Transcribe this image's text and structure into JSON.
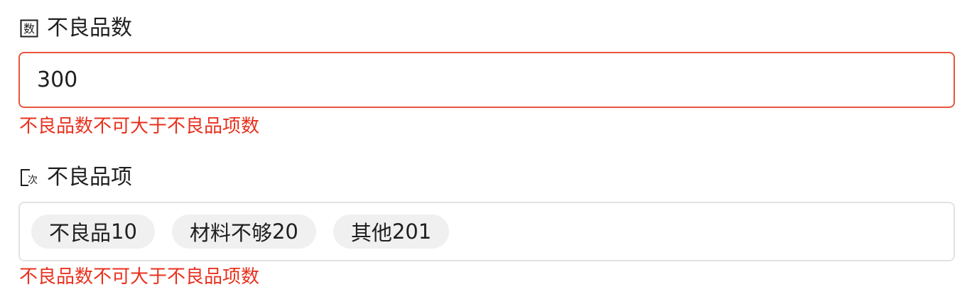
{
  "defect_count": {
    "label": "不良品数",
    "icon": "number-field-icon",
    "value": "300",
    "error": "不良品数不可大于不良品项数"
  },
  "defect_items": {
    "label": "不良品项",
    "icon": "tag-field-icon",
    "tags": [
      {
        "name": "不良品",
        "count": "10"
      },
      {
        "name": "材料不够",
        "count": "20"
      },
      {
        "name": "其他",
        "count": "201"
      }
    ],
    "error": "不良品数不可大于不良品项数"
  },
  "colors": {
    "error": "#e8321f",
    "error_border": "#e8553c",
    "tag_background": "#f0f0f0",
    "border": "#e3e3e3"
  }
}
